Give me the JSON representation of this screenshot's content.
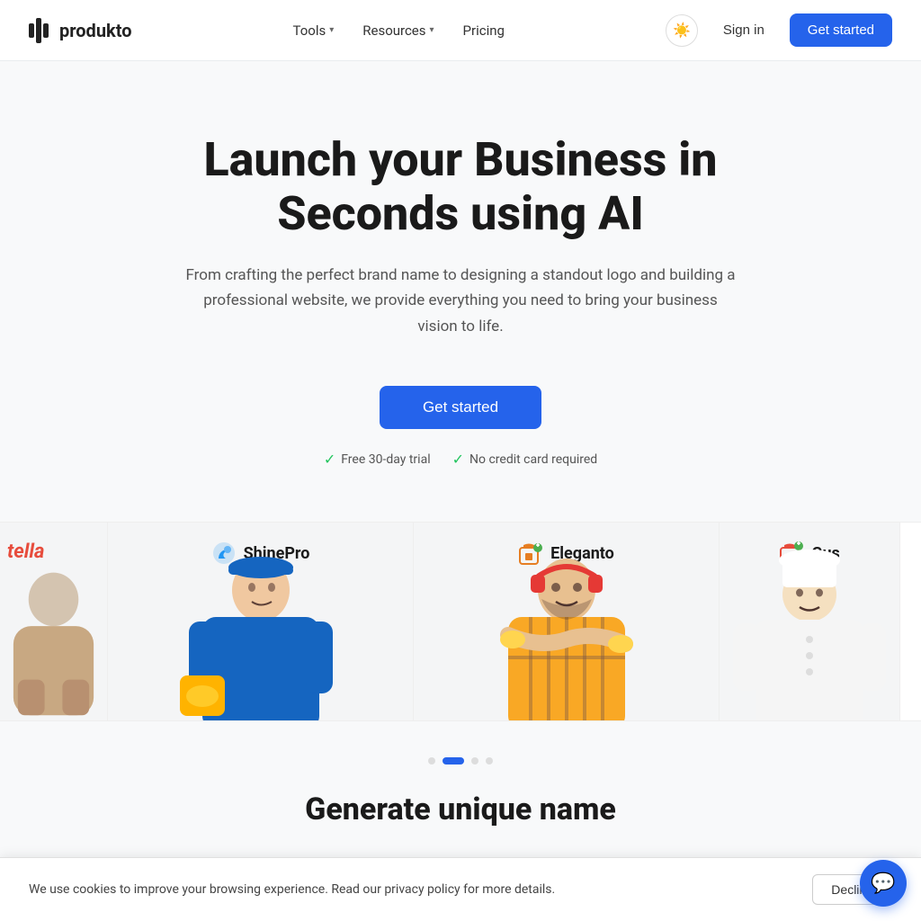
{
  "nav": {
    "logo_text": "produkto",
    "links": [
      {
        "label": "Tools",
        "has_dropdown": true
      },
      {
        "label": "Resources",
        "has_dropdown": true
      },
      {
        "label": "Pricing",
        "has_dropdown": false
      }
    ],
    "sign_in": "Sign in",
    "get_started": "Get started"
  },
  "hero": {
    "title_line1": "Launch your Business in",
    "title_line2": "Seconds using AI",
    "description": "From crafting the perfect brand name to designing a standout logo and building a professional website, we provide everything you need to bring your business vision to life.",
    "cta_label": "Get started",
    "badge1": "Free 30-day trial",
    "badge2": "No credit card required"
  },
  "logos": [
    {
      "name": "tella",
      "partial": true
    },
    {
      "name": "ShinePro",
      "icon_color": "#2196f3"
    },
    {
      "name": "Eleganto",
      "icon_color": "#e67e22"
    },
    {
      "name": "Gusto",
      "icon_color": "#e74c3c",
      "partial_right": true
    }
  ],
  "bottom": {
    "title": "Generate unique name"
  },
  "cookie": {
    "text": "We use cookies to improve your browsing experience. Read our privacy policy for more details.",
    "decline_label": "Decline"
  }
}
